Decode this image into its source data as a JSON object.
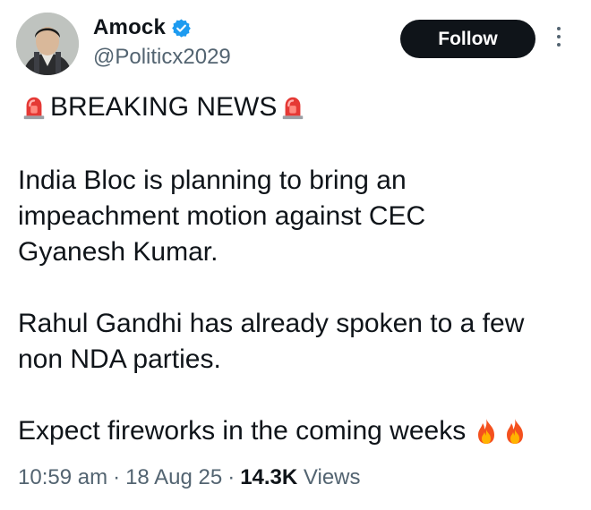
{
  "author": {
    "display_name": "Amock",
    "handle": "@Politicx2029"
  },
  "actions": {
    "follow_label": "Follow"
  },
  "tweet": {
    "headline": "BREAKING NEWS",
    "para1_line1": "India Bloc is planning to bring an",
    "para1_line2": "impeachment motion against CEC",
    "para1_line3": "Gyanesh Kumar.",
    "para2_line1": "Rahul Gandhi has already spoken to a few",
    "para2_line2": "non NDA parties.",
    "para3_line1": "Expect fireworks in the coming weeks"
  },
  "meta": {
    "time": "10:59 am",
    "date": "18 Aug 25",
    "views_count": "14.3K",
    "views_label": "Views",
    "separator": "·"
  },
  "colors": {
    "accent_blue": "#1d9bf0",
    "text_primary": "#0f1419",
    "text_secondary": "#536471"
  },
  "icons": [
    "verified-badge-icon",
    "more-options-icon",
    "siren-icon",
    "fire-icon"
  ]
}
